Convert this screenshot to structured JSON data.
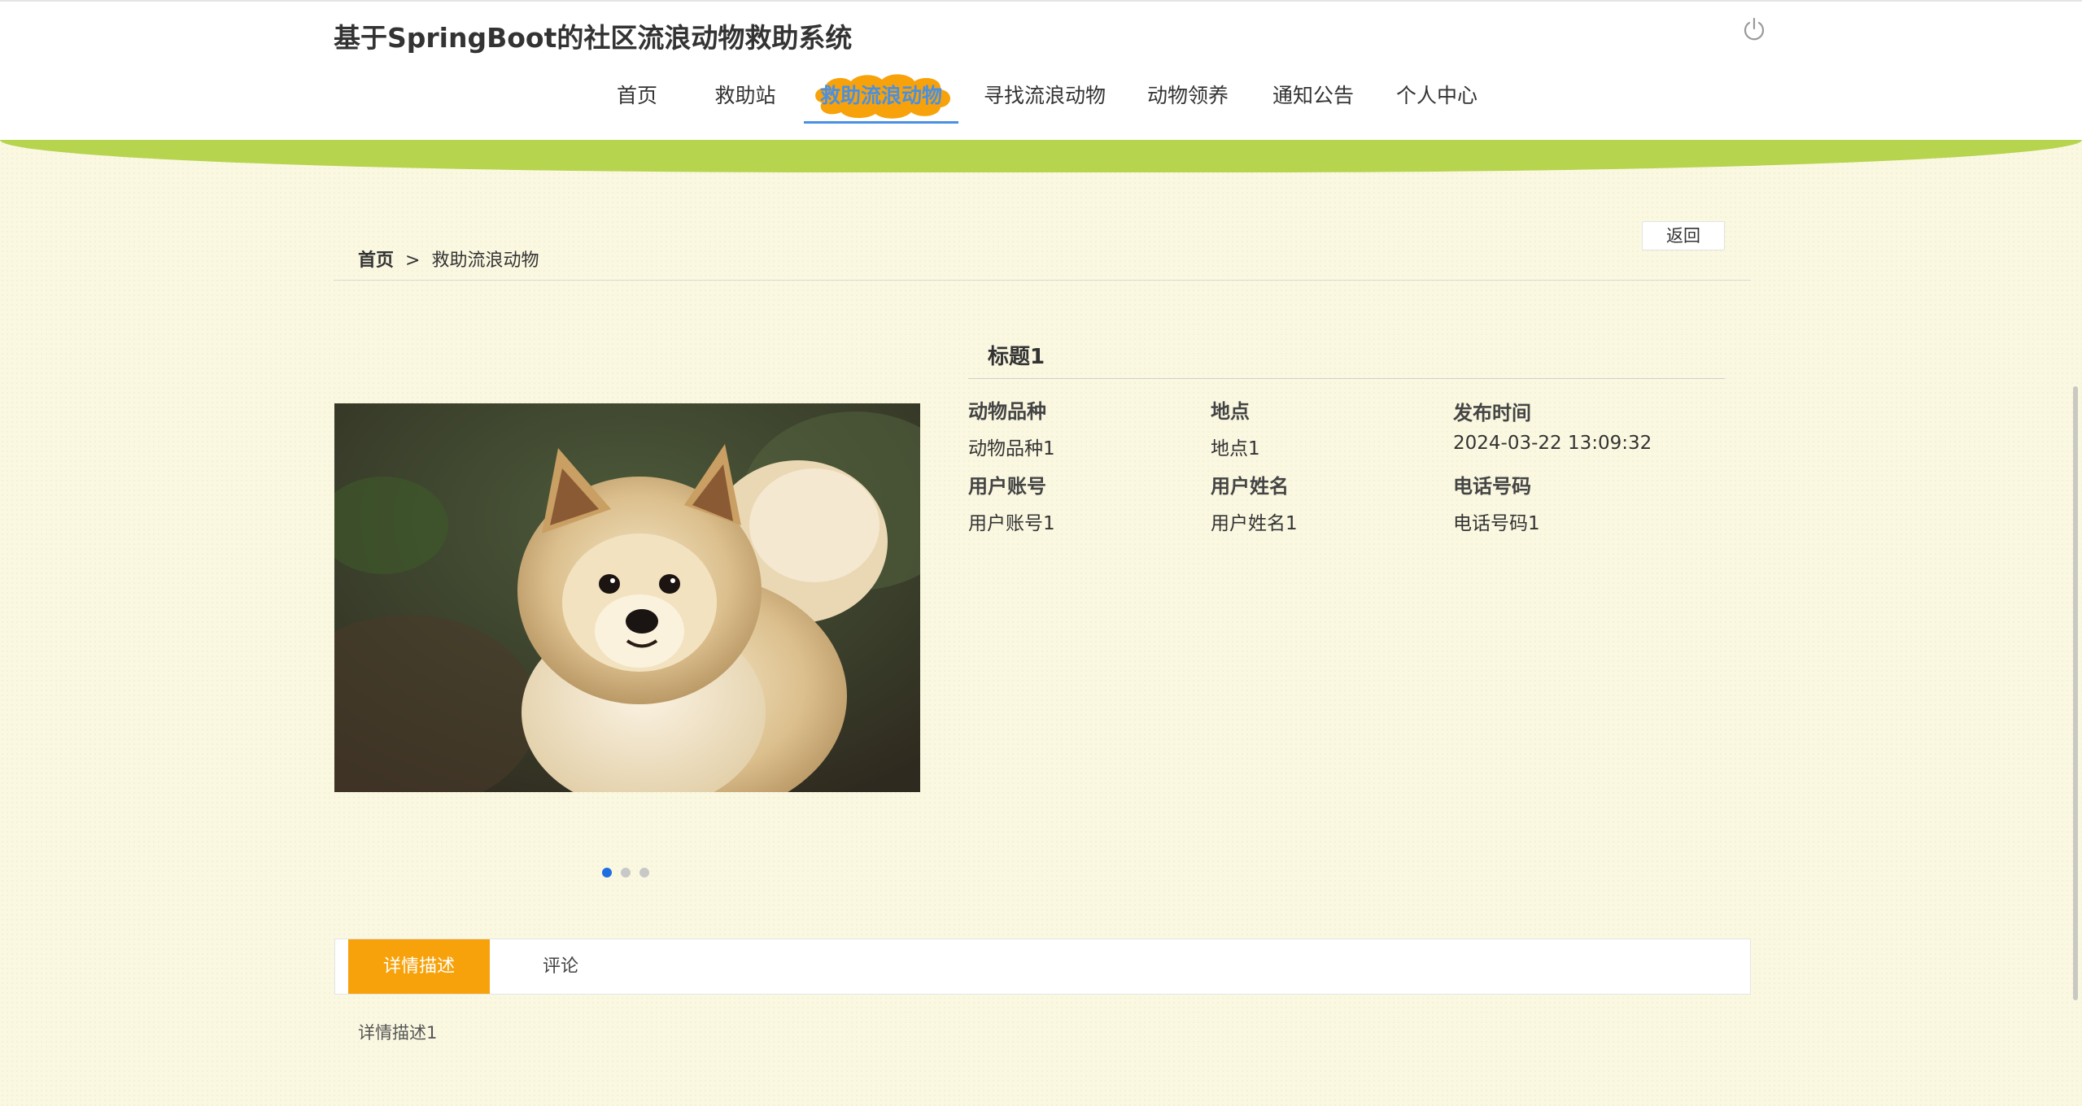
{
  "site": {
    "title": "基于SpringBoot的社区流浪动物救助系统"
  },
  "nav": {
    "items": [
      {
        "label": "首页"
      },
      {
        "label": "救助站"
      },
      {
        "label": "救助流浪动物"
      },
      {
        "label": "寻找流浪动物"
      },
      {
        "label": "动物领养"
      },
      {
        "label": "通知公告"
      },
      {
        "label": "个人中心"
      }
    ],
    "active_index": 2,
    "active_color": "#4a90e2",
    "highlight_color": "#f7a20a"
  },
  "breadcrumb": {
    "home": "首页",
    "separator": ">",
    "current": "救助流浪动物"
  },
  "back_button": "返回",
  "detail": {
    "title": "标题1",
    "fields": {
      "breed_label": "动物品种",
      "breed_value": "动物品种1",
      "location_label": "地点",
      "location_value": "地点1",
      "publish_time_label": "发布时间",
      "publish_time_value": "2024-03-22 13:09:32",
      "account_label": "用户账号",
      "account_value": "用户账号1",
      "name_label": "用户姓名",
      "name_value": "用户姓名1",
      "phone_label": "电话号码",
      "phone_value": "电话号码1"
    }
  },
  "carousel": {
    "slide_count": 3,
    "active_slide": 1
  },
  "tabs": {
    "detail_label": "详情描述",
    "comment_label": "评论",
    "active": "detail"
  },
  "description_text": "详情描述1",
  "colors": {
    "green_band": "#b6d44e",
    "tab_active": "#f7a20a",
    "dot_active": "#1e6fe0"
  }
}
